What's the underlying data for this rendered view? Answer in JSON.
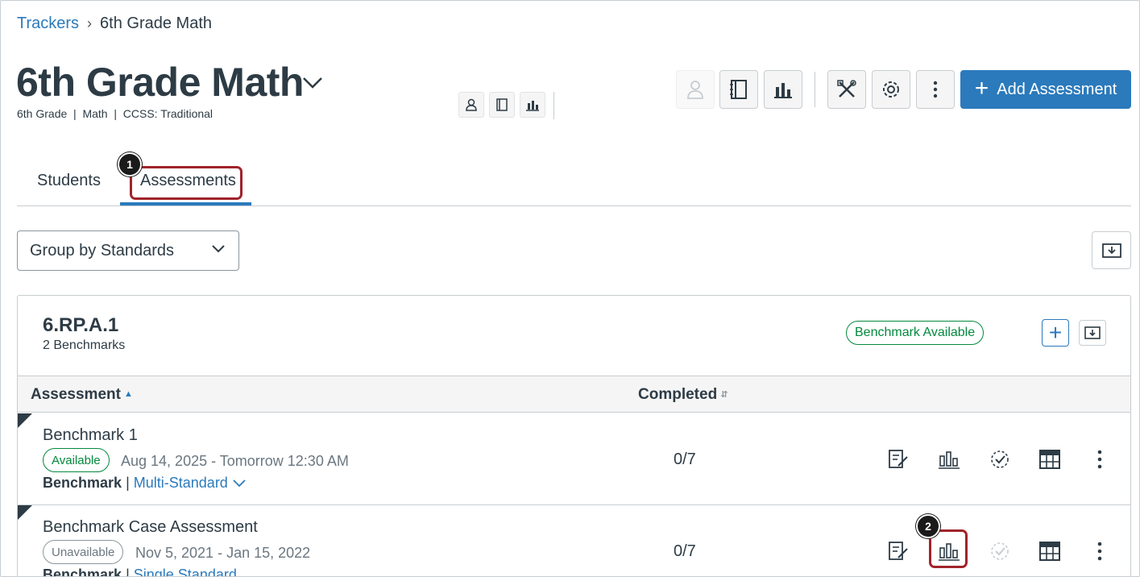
{
  "breadcrumb": {
    "root": "Trackers",
    "current": "6th Grade Math"
  },
  "header": {
    "title": "6th Grade Math",
    "subtitle": "6th Grade  |  Math  |  CCSS: Traditional"
  },
  "toolbar": {
    "add_assessment_label": "Add Assessment"
  },
  "tabs": [
    {
      "label": "Students",
      "active": false
    },
    {
      "label": "Assessments",
      "active": true
    }
  ],
  "callouts": [
    "1",
    "2"
  ],
  "group_select": {
    "value": "Group by Standards"
  },
  "standard_card": {
    "title": "6.RP.A.1",
    "subtitle": "2 Benchmarks",
    "badge": "Benchmark Available"
  },
  "table": {
    "columns": {
      "assessment": "Assessment",
      "completed": "Completed"
    },
    "rows": [
      {
        "name": "Benchmark 1",
        "status": "Available",
        "dates": "Aug 14, 2025 - Tomorrow 12:30 AM",
        "type": "Benchmark",
        "standard": "Multi-Standard",
        "completed": "0/7"
      },
      {
        "name": "Benchmark Case Assessment",
        "status": "Unavailable",
        "dates": "Nov 5, 2021 - Jan 15, 2022",
        "type": "Benchmark",
        "standard": "Single Standard",
        "completed": "0/7"
      }
    ]
  },
  "colors": {
    "accent": "#2b7abc",
    "success": "#03893d",
    "callout": "#a1232b",
    "text": "#2d3b45"
  }
}
